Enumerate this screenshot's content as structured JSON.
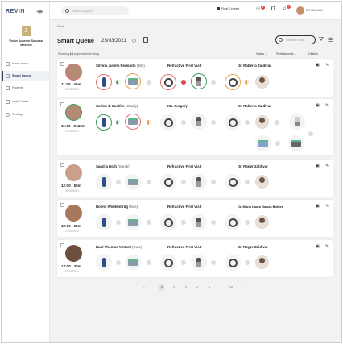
{
  "app": {
    "logo": "REVIN"
  },
  "org": {
    "name": "Visión Superior Sucursal Medellín",
    "badge": "Z"
  },
  "nav": [
    {
      "label": "Iconic menu",
      "icon": "grid-icon",
      "active": false
    },
    {
      "label": "Smart Queue",
      "icon": "queue-icon",
      "active": true
    },
    {
      "label": "Patients",
      "icon": "patients-icon",
      "active": false
    },
    {
      "label": "Help Center",
      "icon": "help-icon",
      "active": false
    },
    {
      "label": "Settings",
      "icon": "gear-icon",
      "active": false
    }
  ],
  "header": {
    "search_placeholder": "Search keyword",
    "final_expired": "Final Expired",
    "notif_badge": "2",
    "alert_badge": "1",
    "username": "DR MANGOA"
  },
  "page": {
    "back": "Back",
    "title": "Smart Queue",
    "date": "23/03/2021",
    "search_placeholder": "Search in cards",
    "showing_prefix": "Showing",
    "showing_count": "14",
    "showing_suffix": "appointments today",
    "filters": [
      "Status",
      "Professionals",
      "Citation"
    ]
  },
  "appointments": [
    {
      "name": "Silvina Julieta Redondo",
      "nick": "(Silv)",
      "time": "11:05 | 46m",
      "date": "23/03/2021",
      "procedure": "Refractive First Visit",
      "doctor": "Dr. Roberto Zaldivar"
    },
    {
      "name": "Carlos J. Castillo",
      "nick": "(Charly)",
      "time": "11:30 | 3h20m",
      "date": "23/03/2021",
      "procedure": "ICL Surgery",
      "doctor": "Dr. Roberto Zaldivar"
    },
    {
      "name": "Sandra Roth",
      "nick": "(Sandri)",
      "time": "12:00 | 50m",
      "date": "23/03/2021",
      "procedure": "Refractive First Visit",
      "doctor": "Dr. Roger Zaldivar"
    },
    {
      "name": "Noemi Wiedenbrüg",
      "nick": "(Noe)",
      "time": "12:00 | 50m",
      "date": "23/03/2021",
      "procedure": "Refractive First Visit",
      "doctor": "Dr. María Laura García Bohler"
    },
    {
      "name": "Raul Thomas Vintard",
      "nick": "(Rulo)",
      "time": "13:00 | 30m",
      "date": "23/03/2021",
      "procedure": "Refractive First Visit",
      "doctor": "Dr. Roger Zaldivar"
    }
  ],
  "pagination": [
    "1",
    "2",
    "3",
    "4",
    "5",
    "...",
    "20"
  ]
}
